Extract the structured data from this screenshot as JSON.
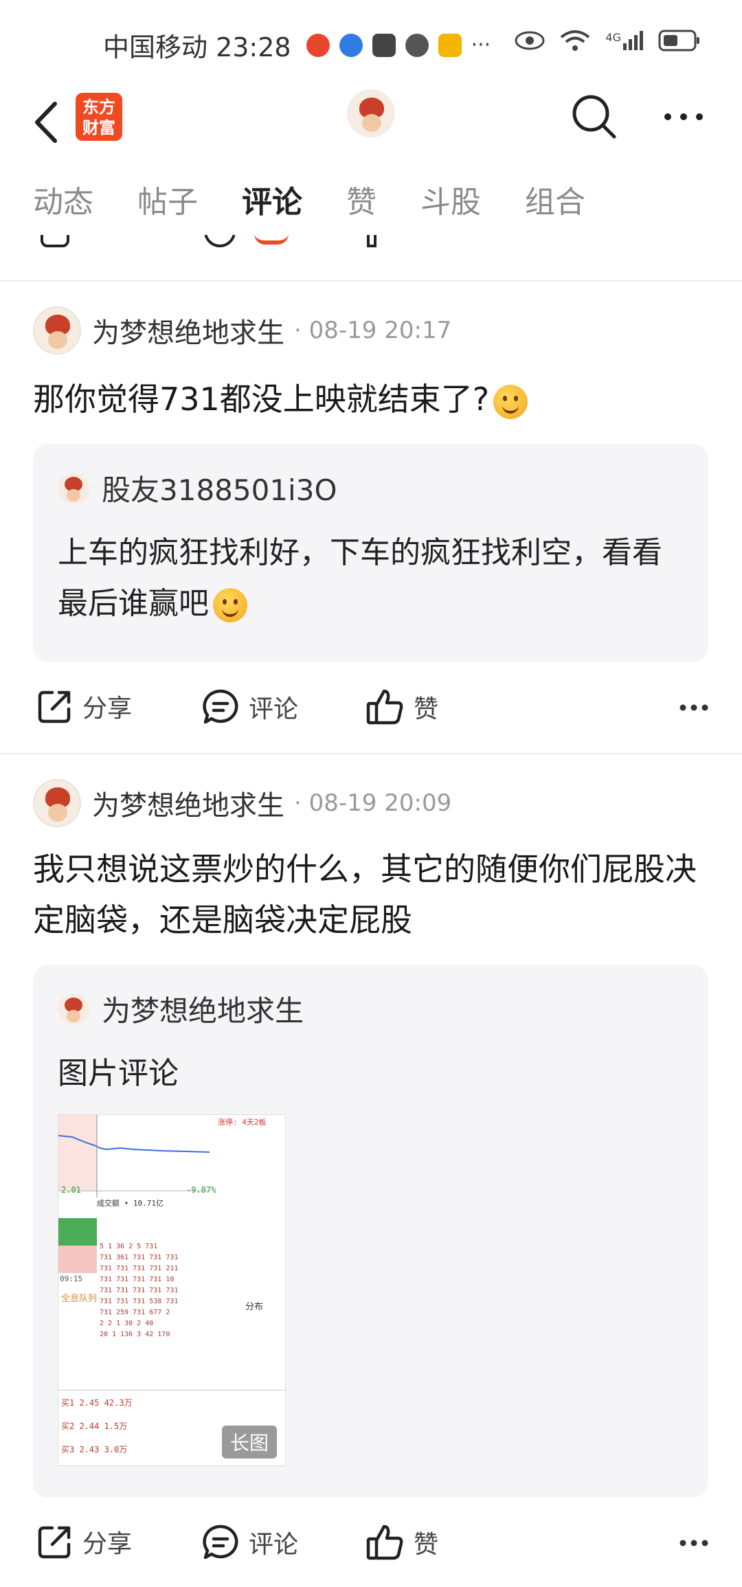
{
  "status_bar": {
    "carrier_time": "中国移动 23:28",
    "more": "···",
    "network": "4G"
  },
  "header": {
    "logo_text_line1": "东方",
    "logo_text_line2": "财富"
  },
  "tabs": [
    {
      "label": "动态",
      "active": false
    },
    {
      "label": "帖子",
      "active": false
    },
    {
      "label": "评论",
      "active": true
    },
    {
      "label": "赞",
      "active": false
    },
    {
      "label": "斗股",
      "active": false
    },
    {
      "label": "组合",
      "active": false
    }
  ],
  "comments": [
    {
      "username": "为梦想绝地求生",
      "time": "· 08-19 20:17",
      "text": "那你觉得731都没上映就结束了?",
      "quote": {
        "username": "股友3188501i3O",
        "text": "上车的疯狂找利好，下车的疯狂找利空，看看最后谁赢吧"
      },
      "actions": {
        "share": "分享",
        "comment": "评论",
        "like": "赞"
      }
    },
    {
      "username": "为梦想绝地求生",
      "time": "· 08-19 20:09",
      "text": "我只想说这票炒的什么，其它的随便你们屁股决定脑袋，还是脑袋决定屁股",
      "quote": {
        "username": "为梦想绝地求生",
        "text": "图片评论",
        "image_badge": "长图",
        "image_texts": {
          "limit_tag": "涨停: 4天2板",
          "price": "2.01",
          "change": "-9.87%",
          "volume": "成交额 • 10.71亿",
          "time_label": "09:15",
          "queue_label": "全息队列",
          "distribution": "分布",
          "rows": [
            "买1 2.45 42.3万",
            "买2 2.44 1.5万",
            "买3 2.43 3.0万"
          ]
        }
      },
      "actions": {
        "share": "分享",
        "comment": "评论",
        "like": "赞"
      }
    }
  ],
  "colors": {
    "accent": "#f04a22",
    "quote_bg": "#f5f5f7",
    "muted_text": "#999999"
  }
}
